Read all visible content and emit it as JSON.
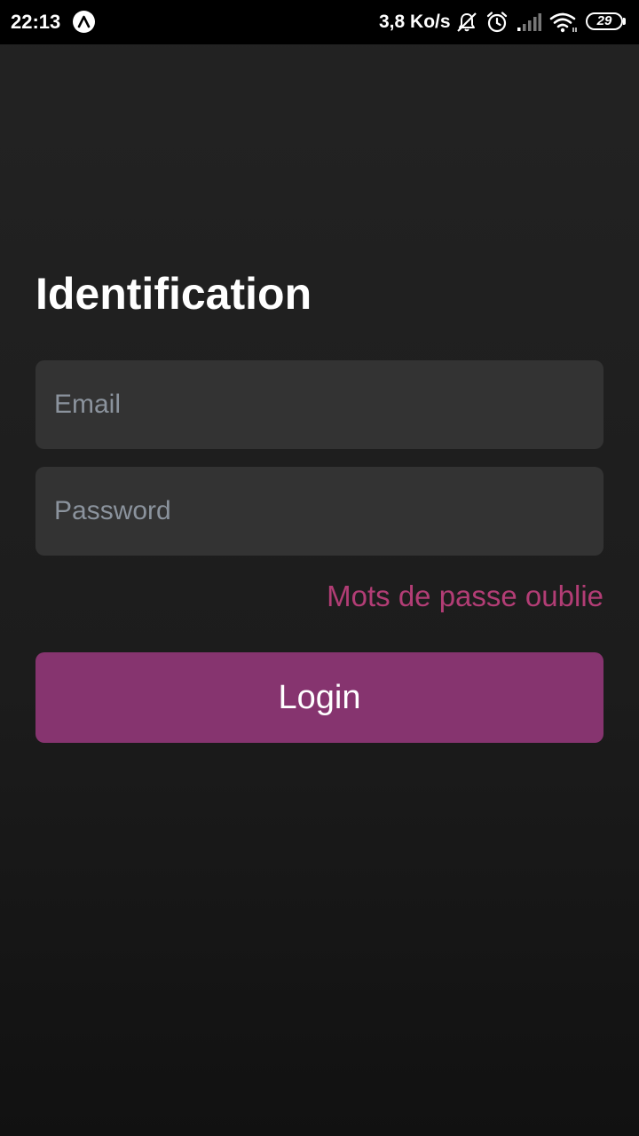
{
  "status_bar": {
    "time": "22:13",
    "network_speed": "3,8 Ko/s",
    "battery_level": "29",
    "icons": [
      "app-launcher-icon",
      "notifications-off-icon",
      "alarm-icon",
      "signal-icon",
      "wifi-icon",
      "battery-icon"
    ]
  },
  "login": {
    "title": "Identification",
    "email_placeholder": "Email",
    "password_placeholder": "Password",
    "forgot_password": "Mots de passe oublie",
    "login_button": "Login"
  },
  "colors": {
    "background": "#1e1e1e",
    "field_background": "#333333",
    "placeholder": "#8b939d",
    "link": "#b23d75",
    "button": "#86346f"
  }
}
